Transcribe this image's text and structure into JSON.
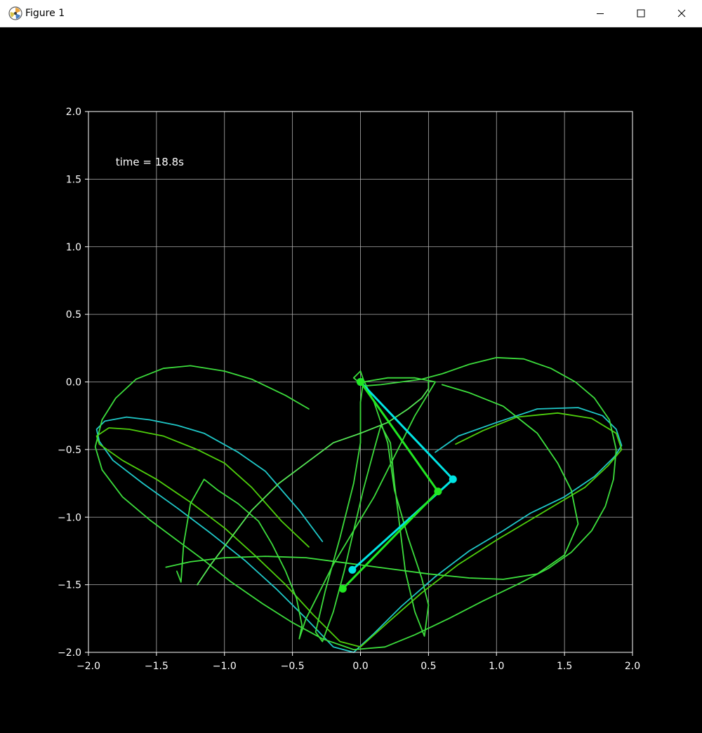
{
  "window": {
    "title": "Figure 1",
    "icons": {
      "app": "matplotlib-icon",
      "minimize": "minimize-icon",
      "maximize": "maximize-icon",
      "close": "close-icon"
    }
  },
  "chart_data": {
    "type": "line",
    "title": "",
    "xlabel": "",
    "ylabel": "",
    "xlim": [
      -2.0,
      2.0
    ],
    "ylim": [
      -2.0,
      2.0
    ],
    "grid": true,
    "background": "#000000",
    "x_ticks": [
      -2.0,
      -1.5,
      -1.0,
      -0.5,
      0.0,
      0.5,
      1.0,
      1.5,
      2.0
    ],
    "x_tick_labels": [
      "−2.0",
      "−1.5",
      "−1.0",
      "−0.5",
      "0.0",
      "0.5",
      "1.0",
      "1.5",
      "2.0"
    ],
    "y_ticks": [
      2.0,
      1.5,
      1.0,
      0.5,
      0.0,
      -0.5,
      -1.0,
      -1.5,
      -2.0
    ],
    "y_tick_labels": [
      "2.0",
      "1.5",
      "1.0",
      "0.5",
      "0.0",
      "−0.5",
      "−1.0",
      "−1.5",
      "−2.0"
    ],
    "annotations": [
      {
        "text": "time = 18.8s",
        "x": -1.8,
        "y": 1.6
      }
    ],
    "pendulums": [
      {
        "color": "#00e5e5",
        "points": [
          [
            0.0,
            0.0
          ],
          [
            0.68,
            -0.72
          ],
          [
            -0.06,
            -1.39
          ]
        ]
      },
      {
        "color": "#22e822",
        "points": [
          [
            0.0,
            0.0
          ],
          [
            0.57,
            -0.81
          ],
          [
            -0.13,
            -1.53
          ]
        ]
      }
    ],
    "series": [
      {
        "color": "#1fc8c8",
        "points": [
          [
            -0.28,
            -1.18
          ],
          [
            -0.45,
            -0.95
          ],
          [
            -0.7,
            -0.66
          ],
          [
            -0.9,
            -0.52
          ],
          [
            -1.15,
            -0.38
          ],
          [
            -1.35,
            -0.32
          ],
          [
            -1.55,
            -0.28
          ],
          [
            -1.72,
            -0.26
          ],
          [
            -1.88,
            -0.29
          ],
          [
            -1.94,
            -0.35
          ],
          [
            -1.92,
            -0.44
          ],
          [
            -1.82,
            -0.58
          ],
          [
            -1.6,
            -0.75
          ],
          [
            -1.35,
            -0.93
          ],
          [
            -1.1,
            -1.12
          ],
          [
            -0.85,
            -1.32
          ],
          [
            -0.62,
            -1.53
          ],
          [
            -0.4,
            -1.75
          ],
          [
            -0.2,
            -1.96
          ],
          [
            -0.05,
            -2.0
          ],
          [
            0.1,
            -1.86
          ],
          [
            0.3,
            -1.66
          ],
          [
            0.55,
            -1.44
          ],
          [
            0.8,
            -1.25
          ],
          [
            1.05,
            -1.1
          ],
          [
            1.25,
            -0.97
          ],
          [
            1.5,
            -0.85
          ],
          [
            1.72,
            -0.7
          ],
          [
            1.87,
            -0.55
          ],
          [
            1.92,
            -0.47
          ],
          [
            1.88,
            -0.35
          ],
          [
            1.78,
            -0.25
          ],
          [
            1.6,
            -0.19
          ],
          [
            1.3,
            -0.2
          ],
          [
            1.0,
            -0.3
          ],
          [
            0.72,
            -0.4
          ],
          [
            0.55,
            -0.52
          ]
        ]
      },
      {
        "color": "#4ecf0c",
        "points": [
          [
            -0.38,
            -1.22
          ],
          [
            -0.58,
            -1.03
          ],
          [
            -0.8,
            -0.78
          ],
          [
            -1.0,
            -0.6
          ],
          [
            -1.2,
            -0.5
          ],
          [
            -1.45,
            -0.4
          ],
          [
            -1.7,
            -0.35
          ],
          [
            -1.85,
            -0.34
          ],
          [
            -1.94,
            -0.4
          ],
          [
            -1.92,
            -0.46
          ],
          [
            -1.75,
            -0.58
          ],
          [
            -1.5,
            -0.72
          ],
          [
            -1.25,
            -0.89
          ],
          [
            -1.0,
            -1.08
          ],
          [
            -0.78,
            -1.28
          ],
          [
            -0.55,
            -1.5
          ],
          [
            -0.35,
            -1.72
          ],
          [
            -0.15,
            -1.92
          ],
          [
            0.0,
            -1.96
          ],
          [
            0.2,
            -1.78
          ],
          [
            0.45,
            -1.56
          ],
          [
            0.72,
            -1.35
          ],
          [
            1.0,
            -1.17
          ],
          [
            1.2,
            -1.05
          ],
          [
            1.45,
            -0.9
          ],
          [
            1.65,
            -0.78
          ],
          [
            1.82,
            -0.62
          ],
          [
            1.92,
            -0.5
          ],
          [
            1.88,
            -0.38
          ],
          [
            1.7,
            -0.27
          ],
          [
            1.45,
            -0.23
          ],
          [
            1.15,
            -0.26
          ],
          [
            0.9,
            -0.36
          ],
          [
            0.7,
            -0.46
          ]
        ]
      },
      {
        "color": "#3cdc3c",
        "points": [
          [
            -0.38,
            -0.2
          ],
          [
            -0.55,
            -0.1
          ],
          [
            -0.8,
            0.02
          ],
          [
            -1.0,
            0.08
          ],
          [
            -1.25,
            0.12
          ],
          [
            -1.45,
            0.1
          ],
          [
            -1.65,
            0.02
          ],
          [
            -1.8,
            -0.12
          ],
          [
            -1.9,
            -0.28
          ],
          [
            -1.95,
            -0.48
          ],
          [
            -1.9,
            -0.65
          ],
          [
            -1.75,
            -0.85
          ],
          [
            -1.55,
            -1.02
          ],
          [
            -1.35,
            -1.17
          ],
          [
            -1.15,
            -1.32
          ],
          [
            -0.95,
            -1.48
          ],
          [
            -0.72,
            -1.64
          ],
          [
            -0.5,
            -1.78
          ],
          [
            -0.28,
            -1.9
          ],
          [
            -0.05,
            -1.98
          ],
          [
            0.18,
            -1.96
          ],
          [
            0.4,
            -1.87
          ],
          [
            0.65,
            -1.75
          ],
          [
            0.9,
            -1.62
          ],
          [
            1.15,
            -1.5
          ],
          [
            1.38,
            -1.38
          ],
          [
            1.55,
            -1.26
          ],
          [
            1.7,
            -1.1
          ],
          [
            1.8,
            -0.92
          ],
          [
            1.86,
            -0.72
          ],
          [
            1.88,
            -0.5
          ],
          [
            1.83,
            -0.28
          ],
          [
            1.72,
            -0.12
          ],
          [
            1.58,
            0.0
          ],
          [
            1.4,
            0.1
          ],
          [
            1.2,
            0.17
          ],
          [
            1.0,
            0.18
          ],
          [
            0.8,
            0.13
          ],
          [
            0.6,
            0.06
          ],
          [
            0.45,
            0.02
          ],
          [
            0.3,
            0.0
          ],
          [
            0.15,
            -0.02
          ],
          [
            0.02,
            -0.03
          ],
          [
            -0.05,
            0.03
          ],
          [
            0.0,
            0.08
          ],
          [
            0.02,
            0.02
          ],
          [
            0.1,
            -0.15
          ],
          [
            0.2,
            -0.45
          ],
          [
            0.25,
            -0.8
          ],
          [
            0.35,
            -1.15
          ],
          [
            0.45,
            -1.45
          ],
          [
            0.5,
            -1.65
          ],
          [
            0.47,
            -1.88
          ],
          [
            0.4,
            -1.7
          ],
          [
            0.33,
            -1.4
          ],
          [
            0.28,
            -1.0
          ],
          [
            0.25,
            -0.75
          ],
          [
            0.22,
            -0.45
          ],
          [
            0.15,
            -0.32
          ],
          [
            0.1,
            -0.5
          ],
          [
            0.02,
            -0.8
          ],
          [
            -0.05,
            -1.1
          ],
          [
            -0.12,
            -1.4
          ],
          [
            -0.2,
            -1.7
          ],
          [
            -0.28,
            -1.92
          ],
          [
            -0.33,
            -1.85
          ],
          [
            -0.26,
            -1.55
          ],
          [
            -0.15,
            -1.15
          ],
          [
            -0.05,
            -0.75
          ],
          [
            0.0,
            -0.45
          ],
          [
            0.0,
            -0.15
          ],
          [
            0.02,
            0.0
          ],
          [
            0.2,
            0.03
          ],
          [
            0.4,
            0.03
          ],
          [
            0.55,
            0.0
          ],
          [
            0.4,
            -0.25
          ],
          [
            0.25,
            -0.55
          ],
          [
            0.1,
            -0.85
          ],
          [
            -0.05,
            -1.1
          ],
          [
            -0.2,
            -1.35
          ],
          [
            -0.3,
            -1.55
          ],
          [
            -0.4,
            -1.75
          ],
          [
            -0.45,
            -1.9
          ],
          [
            -0.43,
            -1.8
          ],
          [
            -0.47,
            -1.6
          ],
          [
            -0.55,
            -1.4
          ],
          [
            -0.65,
            -1.2
          ],
          [
            -0.75,
            -1.03
          ],
          [
            -0.9,
            -0.9
          ],
          [
            -1.05,
            -0.8
          ],
          [
            -1.15,
            -0.72
          ],
          [
            -1.25,
            -0.9
          ],
          [
            -1.3,
            -1.2
          ],
          [
            -1.32,
            -1.48
          ],
          [
            -1.35,
            -1.4
          ]
        ]
      },
      {
        "color": "#56e856",
        "points": [
          [
            -1.2,
            -1.5
          ],
          [
            -1.1,
            -1.35
          ],
          [
            -0.95,
            -1.15
          ],
          [
            -0.8,
            -0.95
          ],
          [
            -0.6,
            -0.75
          ],
          [
            -0.4,
            -0.6
          ],
          [
            -0.2,
            -0.45
          ],
          [
            0.0,
            -0.38
          ],
          [
            0.2,
            -0.3
          ],
          [
            0.35,
            -0.2
          ],
          [
            0.45,
            -0.12
          ],
          [
            0.5,
            -0.05
          ],
          [
            0.5,
            0.0
          ]
        ]
      },
      {
        "color": "#3ee23e",
        "points": [
          [
            -1.43,
            -1.37
          ],
          [
            -1.25,
            -1.33
          ],
          [
            -1.0,
            -1.3
          ],
          [
            -0.7,
            -1.29
          ],
          [
            -0.4,
            -1.3
          ],
          [
            -0.1,
            -1.34
          ],
          [
            0.2,
            -1.38
          ],
          [
            0.5,
            -1.42
          ],
          [
            0.8,
            -1.45
          ],
          [
            1.05,
            -1.46
          ],
          [
            1.3,
            -1.42
          ],
          [
            1.5,
            -1.28
          ],
          [
            1.6,
            -1.05
          ],
          [
            1.55,
            -0.8
          ],
          [
            1.45,
            -0.6
          ],
          [
            1.3,
            -0.38
          ],
          [
            1.05,
            -0.18
          ],
          [
            0.8,
            -0.08
          ],
          [
            0.6,
            -0.02
          ]
        ]
      }
    ]
  }
}
